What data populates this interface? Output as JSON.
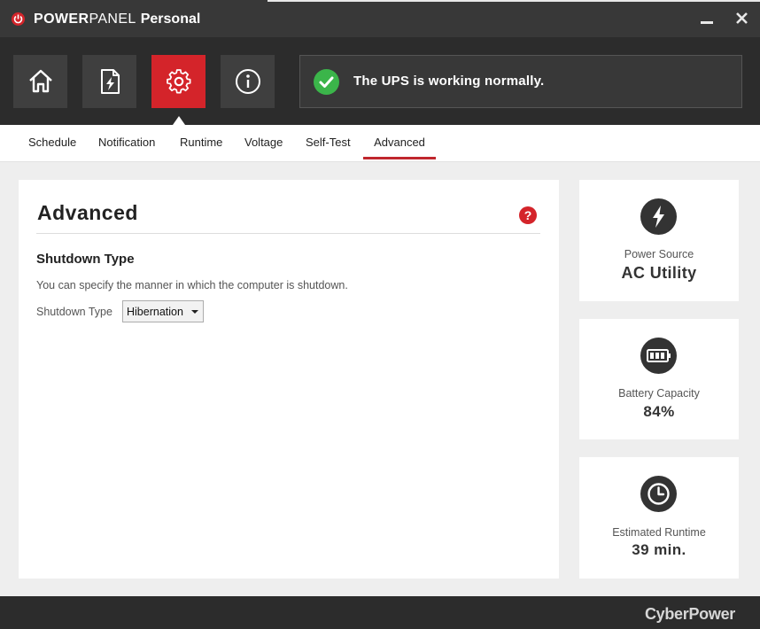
{
  "window": {
    "title_part1": "POWER",
    "title_part2": "PANEL",
    "title_part3": "Personal",
    "logo_icon": "power-icon",
    "minimize_icon": "minimize-icon",
    "close_icon": "close-icon"
  },
  "nav": {
    "buttons": [
      {
        "icon": "home-icon",
        "active": false
      },
      {
        "icon": "power-source-doc-icon",
        "active": false
      },
      {
        "icon": "gear-icon",
        "active": true
      },
      {
        "icon": "info-icon",
        "active": false
      }
    ],
    "active_color": "#d4242a"
  },
  "status": {
    "icon": "check-icon",
    "text": "The UPS is working normally.",
    "color": "#3bb54a"
  },
  "tabs": [
    {
      "label": "Schedule",
      "active": false
    },
    {
      "label": "Notification",
      "active": false
    },
    {
      "label": "Runtime",
      "active": false
    },
    {
      "label": "Voltage",
      "active": false
    },
    {
      "label": "Self-Test",
      "active": false
    },
    {
      "label": "Advanced",
      "active": true
    }
  ],
  "panel": {
    "title": "Advanced",
    "help_label": "?",
    "section_title": "Shutdown Type",
    "description": "You can specify the manner in which the computer is shutdown.",
    "field_label": "Shutdown Type",
    "selected_option": "Hibernation"
  },
  "cards": {
    "power_source": {
      "icon": "lightning-icon",
      "label": "Power Source",
      "value": "AC Utility"
    },
    "battery": {
      "icon": "battery-icon",
      "label": "Battery Capacity",
      "value": "84%"
    },
    "runtime": {
      "icon": "clock-icon",
      "label": "Estimated Runtime",
      "value": "39 min."
    }
  },
  "footer": {
    "brand": "CyberPower"
  }
}
